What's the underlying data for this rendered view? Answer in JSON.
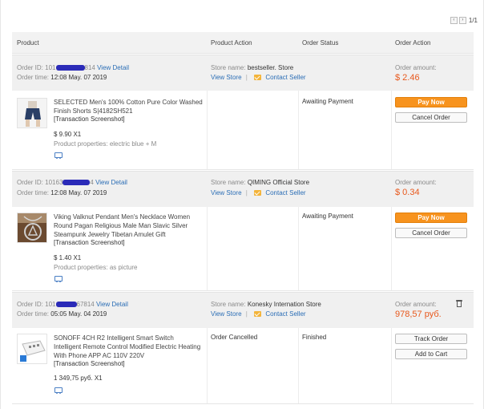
{
  "pager": {
    "prev": "‹",
    "next": "›",
    "text": "1/1"
  },
  "table_header": {
    "product": "Product",
    "product_action": "Product Action",
    "order_status": "Order Status",
    "order_action": "Order Action"
  },
  "labels": {
    "order_id": "Order ID:",
    "order_time": "Order time:",
    "view_detail": "View Detail",
    "store_name": "Store name:",
    "view_store": "View Store",
    "separator": "|",
    "contact_seller": "Contact Seller",
    "order_amount": "Order amount:",
    "transaction_screenshot": "[Transaction Screenshot]"
  },
  "orders": [
    {
      "order_id_prefix": "101",
      "order_id_suffix": "814",
      "order_time": "12:08 May. 07 2019",
      "store_name": "bestseller. Store",
      "amount": "$ 2.46",
      "product_title": "SELECTED Men's 100% Cotton Pure Color Washed Finish Shorts S|4182SH521",
      "price": "$ 9.90 X1",
      "properties": "Product properties: electric blue + M",
      "product_action": "",
      "status": "Awaiting Payment",
      "buttons": [
        "Pay Now",
        "Cancel Order"
      ]
    },
    {
      "order_id_prefix": "10163",
      "order_id_suffix": "4",
      "order_time": "12:08 May. 07 2019",
      "store_name": "QIMING Official Store",
      "amount": "$ 0.34",
      "product_title": "Viking Valknut Pendant Men's Necklace Women Round Pagan Religious Male Man Slavic Silver Steampunk Jewelry Tibetan Amulet Gift",
      "price": "$ 1.40 X1",
      "properties": "Product properties: as picture",
      "product_action": "",
      "status": "Awaiting Payment",
      "buttons": [
        "Pay Now",
        "Cancel Order"
      ]
    },
    {
      "order_id_prefix": "101",
      "order_id_suffix": "67814",
      "order_time": "05:05 May. 04 2019",
      "store_name": "Konesky Internation Store",
      "amount": "978,57 руб.",
      "product_title": "SONOFF 4CH R2 Intelligent Smart Switch Intelligent Remote Control Modified Electric Heating With Phone APP AC 110V 220V",
      "price": "1 349,75 руб. X1",
      "properties": "",
      "product_action": "Order Cancelled",
      "status": "Finished",
      "buttons": [
        "Track Order",
        "Add to Cart"
      ]
    }
  ],
  "colors": {
    "accent_orange": "#f7931e",
    "amount_red": "#e8581c",
    "link_blue": "#2a6db5",
    "header_gray": "#f2f2f2",
    "mask_blue": "#2b2bb8"
  },
  "icons": {
    "mail": "mail-icon",
    "shipping": "truck-icon",
    "delete": "trash-icon"
  }
}
